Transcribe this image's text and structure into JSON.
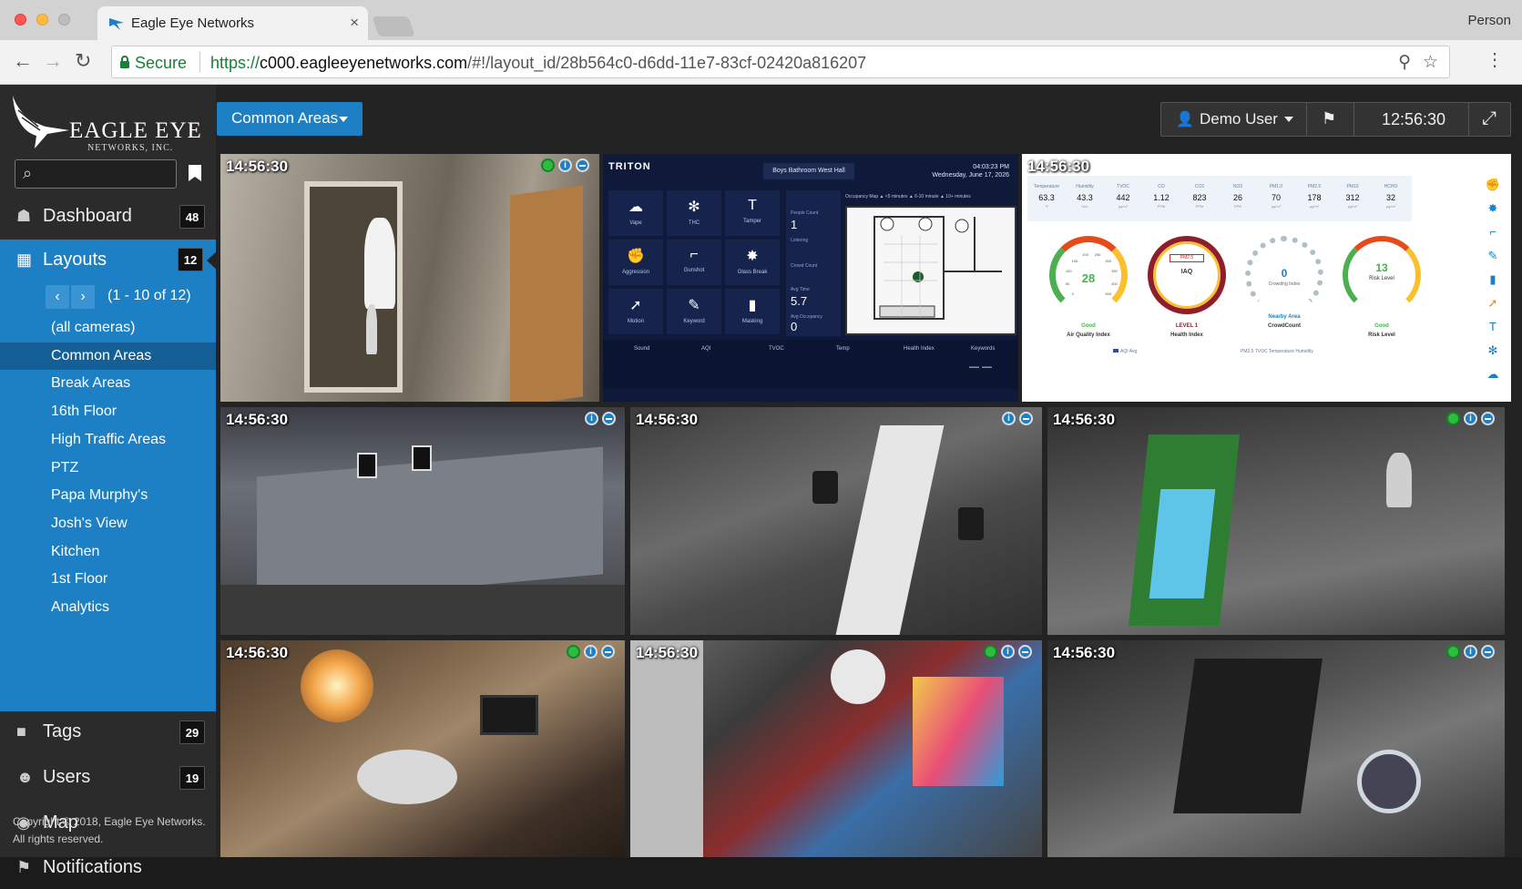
{
  "browser": {
    "tab_title": "Eagle Eye Networks",
    "tab_close": "×",
    "profile": "Person",
    "back": "←",
    "forward": "→",
    "reload": "↻",
    "secure_label": "Secure",
    "url_proto": "https://",
    "url_host": "c000.eagleeyenetworks.com",
    "url_path": "/#!/layout_id/28b564c0-d6dd-11e7-83cf-02420a816207",
    "pin_icon": "⚲",
    "star_icon": "☆",
    "menu_icon": "⋮"
  },
  "logo": {
    "name": "EAGLE EYE",
    "sub": "NETWORKS, INC."
  },
  "search": {
    "placeholder": "",
    "icon": "⌕"
  },
  "nav": {
    "dashboard": {
      "label": "Dashboard",
      "count": "48",
      "icon": "☗"
    },
    "layouts": {
      "label": "Layouts",
      "count": "12",
      "icon": "▦"
    },
    "tags": {
      "label": "Tags",
      "count": "29",
      "icon": "■"
    },
    "users": {
      "label": "Users",
      "count": "19",
      "icon": "☻"
    },
    "map": {
      "label": "Map",
      "icon": "◉"
    },
    "notifications": {
      "label": "Notifications",
      "icon": "⚑"
    }
  },
  "layouts": {
    "pager_prev": "‹",
    "pager_next": "›",
    "pager_text": "(1 - 10 of 12)",
    "items": [
      "(all cameras)",
      "Common Areas",
      "Break Areas",
      "16th Floor",
      "High Traffic Areas",
      "PTZ",
      "Papa Murphy's",
      "Josh's View",
      "Kitchen",
      "1st Floor",
      "Analytics"
    ],
    "active_index": 1
  },
  "copyright": {
    "line1": "Copyright © 2018, Eagle Eye Networks.",
    "line2": "All rights reserved."
  },
  "topbar": {
    "layout_select": "Common Areas",
    "user": "Demo User",
    "user_icon": "👤",
    "flag_icon": "⚑",
    "time": "12:56:30",
    "fullscreen_icon": "⤢"
  },
  "cameras": {
    "timestamp": "14:56:30",
    "info_glyph": "i"
  },
  "triton": {
    "brand": "TRITON",
    "location": "Boys Bathroom West Hall",
    "time": "04:03:23 PM",
    "date": "Wednesday, June 17, 2026",
    "tiles": [
      {
        "label": "Vape",
        "icon": "☁"
      },
      {
        "label": "THC",
        "icon": "✻"
      },
      {
        "label": "Tamper",
        "icon": "T"
      },
      {
        "label": "Aggression",
        "icon": "✊"
      },
      {
        "label": "Gunshot",
        "icon": "⌐"
      },
      {
        "label": "Glass Break",
        "icon": "✸"
      },
      {
        "label": "Motion",
        "icon": "➚"
      },
      {
        "label": "Keyword",
        "icon": "✎"
      },
      {
        "label": "Masking",
        "icon": "▮"
      }
    ],
    "legend": "Occupancy Map     ▲ <5 minutes     ▲ 6-10 minute     ▲ 10+ minutes",
    "people_count_label": "People Count",
    "people_count": "1",
    "loitering_label": "Loitering",
    "crowd_count_label": "Crowd Count",
    "avg_time_label": "Avg Time",
    "avg_time": "5.7",
    "avg_occupancy_label": "Avg Occupancy",
    "avg_occupancy": "0",
    "footer": [
      "Sound",
      "AQI",
      "TVOC",
      "Temp",
      "Health Index",
      "Keywords"
    ],
    "keywords_value": "— —"
  },
  "air": {
    "metrics": [
      {
        "k": "Temperature",
        "v": "63.3",
        "u": "°F"
      },
      {
        "k": "Humidity",
        "v": "43.3",
        "u": "%rh"
      },
      {
        "k": "TVOC",
        "v": "442",
        "u": "µg/m³"
      },
      {
        "k": "CO",
        "v": "1.12",
        "u": "PPM"
      },
      {
        "k": "CO2",
        "v": "823",
        "u": "PPM"
      },
      {
        "k": "NO2",
        "v": "26",
        "u": "PPB"
      },
      {
        "k": "PM1.0",
        "v": "70",
        "u": "µg/m³"
      },
      {
        "k": "PM2.5",
        "v": "178",
        "u": "µg/m³"
      },
      {
        "k": "PM10",
        "v": "312",
        "u": "µg/m³"
      },
      {
        "k": "HCHO",
        "v": "32",
        "u": "µg/m³"
      }
    ],
    "gauges": [
      {
        "value": "28",
        "label": "Air Quality Index",
        "status": "Good"
      },
      {
        "value": "IAQ",
        "label": "Health Index",
        "status": "LEVEL 1"
      },
      {
        "value": "0",
        "label": "CrowdCount",
        "status": "Nearby Area"
      },
      {
        "value": "13",
        "label": "Risk Level",
        "status": "Good"
      }
    ],
    "gauge1_ticks": [
      "0",
      "50",
      "100",
      "150",
      "200",
      "250",
      "300",
      "350",
      "400",
      "500"
    ],
    "gauge2_chip": "PM2.5",
    "gauge3_sub": "Crowding Index",
    "gauge4_sub": "Risk Level",
    "legend_aqi": "AQI Avg",
    "legend_series": "PM2.5   TVOC   Temperature   Humidity"
  }
}
